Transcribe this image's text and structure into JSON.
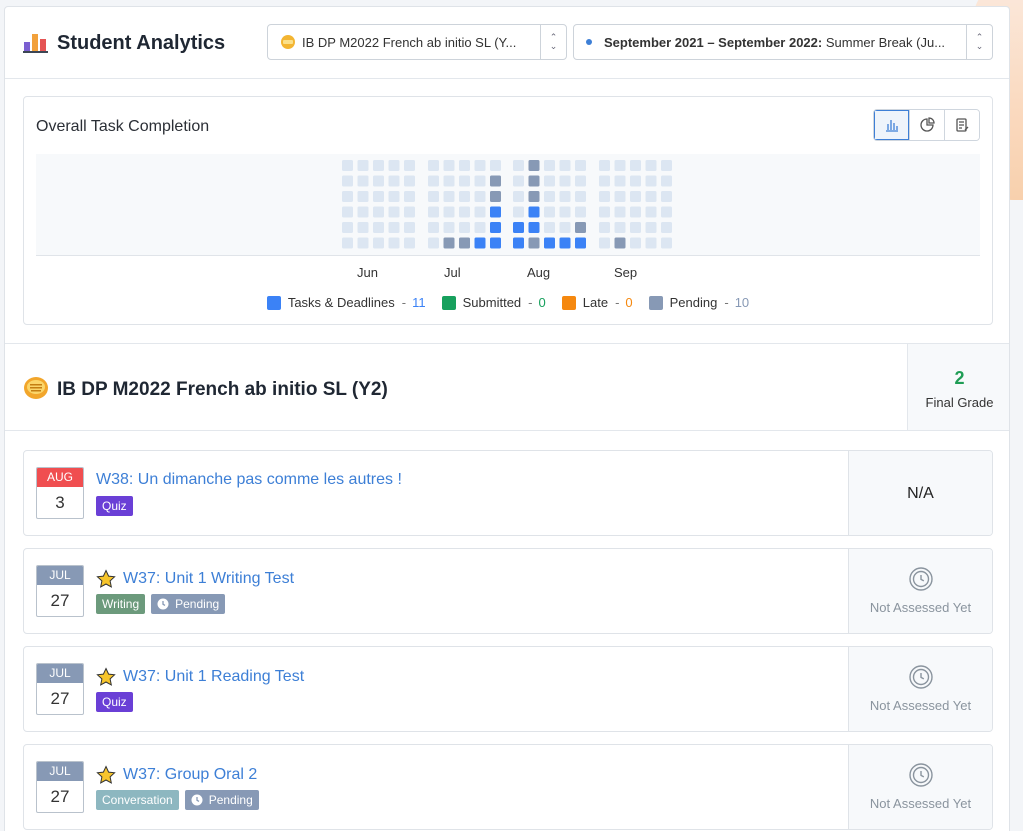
{
  "header": {
    "app_title": "Student Analytics",
    "course_select": "IB DP M2022 French ab initio SL (Y...",
    "period_select_bold": "September 2021 – September 2022:",
    "period_select_rest": " Summer Break (Ju..."
  },
  "chart": {
    "title": "Overall Task Completion",
    "months": [
      "Jun",
      "Jul",
      "Aug",
      "Sep"
    ],
    "legend": [
      {
        "label": "Tasks & Deadlines",
        "count": "11",
        "color": "#3b82f6",
        "count_color": "#3b82f6"
      },
      {
        "label": "Submitted",
        "count": "0",
        "color": "#17a05d",
        "count_color": "#17a05d"
      },
      {
        "label": "Late",
        "count": "0",
        "color": "#f5880f",
        "count_color": "#f5880f"
      },
      {
        "label": "Pending",
        "count": "10",
        "color": "#8799b5",
        "count_color": "#8799b5"
      }
    ]
  },
  "chart_data": {
    "type": "heatmap",
    "title": "Overall Task Completion",
    "months": [
      "Jun",
      "Jul",
      "Aug",
      "Sep"
    ],
    "rows": 6,
    "cols_per_month": 5,
    "cells": {
      "Jun": [
        "0,0,0,0,0",
        "0,0,0,0,0",
        "0,0,0,0,0",
        "0,0,0,0,0",
        "0,0,0,0,0",
        "0,0,0,0,0"
      ],
      "Jul": [
        "0,0,0,0,0",
        "0,0,0,0,2",
        "0,0,0,0,2",
        "0,0,0,0,1",
        "0,0,0,0,1",
        "0,2,2,1,1"
      ],
      "Aug": [
        "0,2,0,0,0",
        "0,2,0,0,0",
        "0,2,0,0,0",
        "0,1,0,0,0",
        "1,1,0,0,2",
        "1,2,1,1,1"
      ],
      "Sep": [
        "0,0,0,0,0",
        "0,0,0,0,0",
        "0,0,0,0,0",
        "0,0,0,0,0",
        "0,0,0,0,0",
        "0,2,0,0,0"
      ]
    },
    "series": [
      {
        "name": "Tasks & Deadlines",
        "value": 11
      },
      {
        "name": "Submitted",
        "value": 0
      },
      {
        "name": "Late",
        "value": 0
      },
      {
        "name": "Pending",
        "value": 10
      }
    ]
  },
  "course": {
    "title": "IB DP M2022 French ab initio SL (Y2)",
    "grade_value": "2",
    "grade_label": "Final Grade"
  },
  "tasks": [
    {
      "month": "AUG",
      "day": "3",
      "name": "W38: Un dimanche pas comme les autres !",
      "star": false,
      "month_color": "#f04e50",
      "tags": [
        {
          "label": "Quiz",
          "color": "#6a3fd6",
          "clock": false
        }
      ],
      "status": "N/A",
      "status_type": "text"
    },
    {
      "month": "JUL",
      "day": "27",
      "name": "W37: Unit 1 Writing Test",
      "star": true,
      "month_color": "#8799b5",
      "tags": [
        {
          "label": "Writing",
          "color": "#6c9a7c",
          "clock": false
        },
        {
          "label": "Pending",
          "color": "#8799b5",
          "clock": true
        }
      ],
      "status": "Not Assessed Yet",
      "status_type": "icon"
    },
    {
      "month": "JUL",
      "day": "27",
      "name": "W37: Unit 1 Reading Test",
      "star": true,
      "month_color": "#8799b5",
      "tags": [
        {
          "label": "Quiz",
          "color": "#6a3fd6",
          "clock": false
        }
      ],
      "status": "Not Assessed Yet",
      "status_type": "icon"
    },
    {
      "month": "JUL",
      "day": "27",
      "name": "W37: Group Oral 2",
      "star": true,
      "month_color": "#8799b5",
      "tags": [
        {
          "label": "Conversation",
          "color": "#8db7c0",
          "clock": false
        },
        {
          "label": "Pending",
          "color": "#8799b5",
          "clock": true
        }
      ],
      "status": "Not Assessed Yet",
      "status_type": "icon"
    }
  ]
}
